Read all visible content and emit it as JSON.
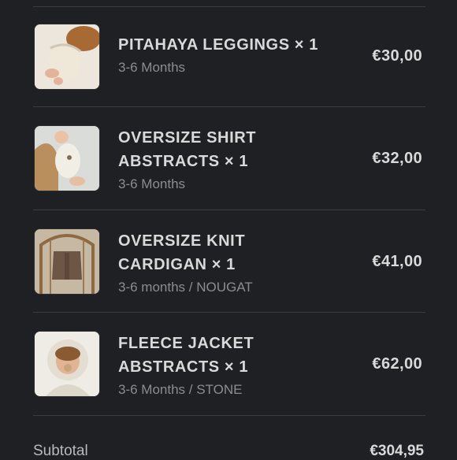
{
  "cart": {
    "items": [
      {
        "name": "PITAHAYA LEGGINGS × 1",
        "name_line2": "",
        "variant": "3-6 Months",
        "price": "€30,00",
        "image_icon": "baby-leggings-photo"
      },
      {
        "name": "OVERSIZE SHIRT",
        "name_line2": "ABSTRACTS × 1",
        "variant": "3-6 Months",
        "price": "€32,00",
        "image_icon": "baby-shirt-photo"
      },
      {
        "name": "OVERSIZE KNIT",
        "name_line2": "CARDIGAN × 1",
        "variant": "3-6 months / NOUGAT",
        "price": "€41,00",
        "image_icon": "knit-cardigan-photo"
      },
      {
        "name": "FLEECE JACKET",
        "name_line2": "ABSTRACTS × 1",
        "variant": "3-6 Months / STONE",
        "price": "€62,00",
        "image_icon": "fleece-jacket-photo"
      }
    ],
    "subtotal_label": "Subtotal",
    "subtotal_value": "€304,95"
  }
}
